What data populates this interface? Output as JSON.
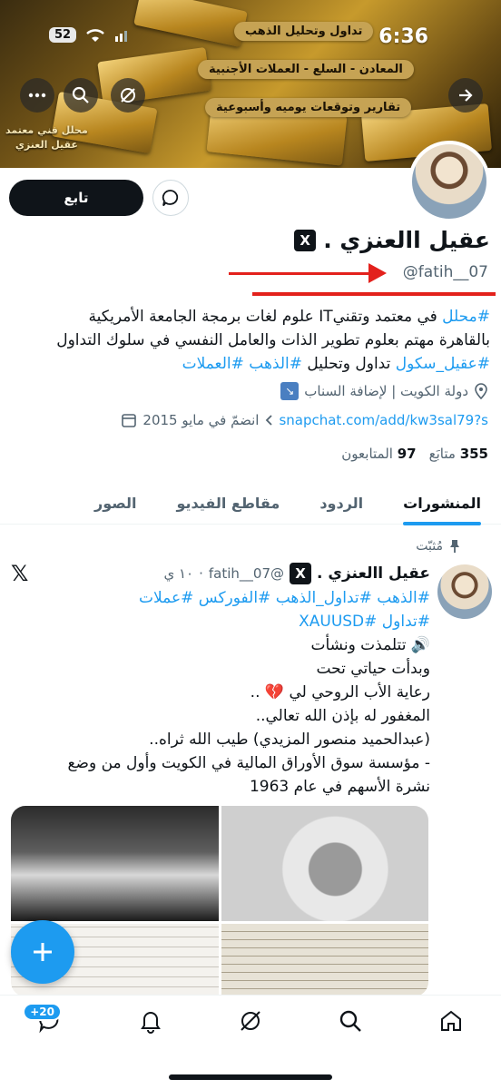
{
  "status": {
    "time": "6:36",
    "battery": "52"
  },
  "banner": {
    "label1": "تداول وتحليل الذهب",
    "label2": "المعادن - السلع - العملات الأجنبية",
    "label3": "تقارير وتوقعات يوميه وأسبوعية",
    "tag_line1": "محلل فني معتمد",
    "tag_line2": "عقيل العنزي"
  },
  "profile": {
    "follow_label": "تابع",
    "display_name": "عقيل االعنزي .",
    "badge": "X",
    "handle": "@fatih__07",
    "bio": {
      "line1_tag": "#محلل",
      "line1_text": " في معتمد وتقنيIT علوم لغات برمجة الجامعة الأمريكية",
      "line2": "بالقاهرة مهتم بعلوم تطوير الذات والعامل النفسي في سلوك التداول",
      "line3_tag1": "#عقيل_سكول",
      "line3_text": " تداول وتحليل ",
      "line3_tag2": "#الذهب",
      "line3_tag3": "#العملات"
    },
    "location": "دولة الكويت | لإضافة السناب",
    "location_emoji": "↘",
    "website": "snapchat.com/add/kw3sal79?s",
    "joined": "انضمّ في مايو 2015",
    "following_count": "355",
    "following_label": "متابَع",
    "followers_count": "97",
    "followers_label": "المتابعون"
  },
  "tabs": [
    {
      "label": "المنشورات",
      "active": true
    },
    {
      "label": "الردود",
      "active": false
    },
    {
      "label": "مقاطع الفيديو",
      "active": false
    },
    {
      "label": "الصور",
      "active": false
    }
  ],
  "post": {
    "pinned_label": "مُثبّت",
    "name": "عقيل االعنزي .",
    "badge": "X",
    "handle": "@fatih__07",
    "time": "١٠ ي",
    "tags_line1": "#الذهب #تداول_الذهب #الفوركس #عملات",
    "tags_line2": "#تداول #XAUUSD",
    "line3": "🔊 تتلمذت ونشأت",
    "line4": "وبدأت حياتي تحت",
    "line5": "رعاية الأب الروحي لي 💔 ..",
    "line6": "المغفور له بإذن الله تعالي..",
    "line7": "(عبدالحميد منصور المزيدي) طيب الله ثراه..",
    "line8": "- مؤسسة سوق الأوراق المالية في الكويت وأول من وضع",
    "line9": "نشرة الأسهم في عام 1963"
  },
  "nav": {
    "messages_badge": "+20"
  },
  "colors": {
    "accent": "#1d9bf0",
    "annotation": "#e3211c",
    "text": "#0f1419"
  }
}
